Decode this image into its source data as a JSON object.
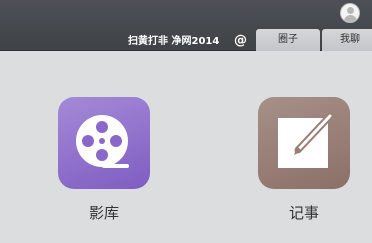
{
  "header": {
    "slogan": "扫黄打非 净网2014",
    "at_symbol": "@",
    "tabs": [
      {
        "label": "圈子"
      },
      {
        "label": "我聊"
      }
    ]
  },
  "apps": [
    {
      "label": "影库",
      "icon": "film-reel-icon",
      "color": "#8f6fcc"
    },
    {
      "label": "记事",
      "icon": "notepad-pen-icon",
      "color": "#9a7f77"
    }
  ],
  "colors": {
    "topbar": "#45484d",
    "background": "#dcdddf",
    "tab": "#cfd0d2"
  }
}
